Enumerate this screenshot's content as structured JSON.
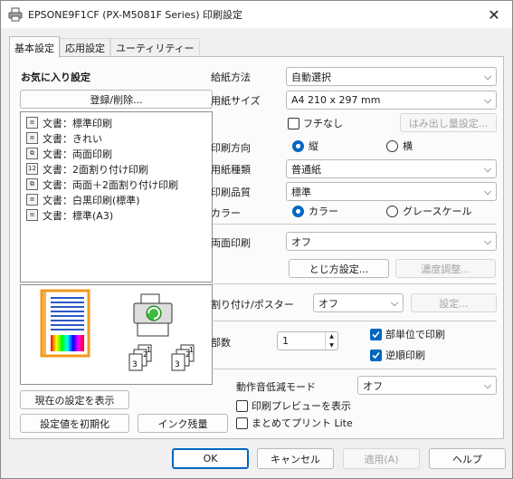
{
  "window": {
    "title": "EPSONE9F1CF (PX-M5081F Series) 印刷設定"
  },
  "tabs": [
    "基本設定",
    "応用設定",
    "ユーティリティー"
  ],
  "favorites": {
    "title": "お気に入り設定",
    "register_button": "登録/削除...",
    "items": [
      "文書：標準印刷",
      "文書：きれい",
      "文書：両面印刷",
      "文書：2面割り付け印刷",
      "文書：両面＋2面割り付け印刷",
      "文書：白黒印刷(標準)",
      "文書：標準(A3)"
    ],
    "item_icons": [
      "document-icon",
      "document-icon",
      "duplex-icon",
      "two-up-icon",
      "duplex-two-up-icon",
      "mono-document-icon",
      "document-icon"
    ]
  },
  "left_buttons": {
    "show_current": "現在の設定を表示",
    "reset": "設定値を初期化",
    "ink_level": "インク残量"
  },
  "settings": {
    "paper_source_label": "給紙方法",
    "paper_source_value": "自動選択",
    "paper_size_label": "用紙サイズ",
    "paper_size_value": "A4 210 x 297 mm",
    "borderless_label": "フチなし",
    "overflow_button": "はみ出し量設定...",
    "orientation_label": "印刷方向",
    "orientation_portrait": "縦",
    "orientation_landscape": "横",
    "paper_type_label": "用紙種類",
    "paper_type_value": "普通紙",
    "quality_label": "印刷品質",
    "quality_value": "標準",
    "color_label": "カラー",
    "color_option": "カラー",
    "grayscale_option": "グレースケール",
    "duplex_label": "両面印刷",
    "duplex_value": "オフ",
    "binding_button": "とじ方設定...",
    "density_button": "濃度調整...",
    "layout_label": "割り付け/ポスター",
    "layout_value": "オフ",
    "layout_settings_button": "設定...",
    "copies_label": "部数",
    "copies_value": "1",
    "collate_label": "部単位で印刷",
    "reverse_label": "逆順印刷",
    "quiet_mode_label": "動作音低減モード",
    "quiet_mode_value": "オフ",
    "print_preview_label": "印刷プレビューを表示",
    "lite_label": "まとめてプリント Lite"
  },
  "footer": {
    "ok": "OK",
    "cancel": "キャンセル",
    "apply": "適用(A)",
    "help": "ヘルプ"
  },
  "colors": {
    "accent": "#0067c0",
    "window_bg": "#f0f0f0",
    "panel_bg": "#fbfbfb"
  }
}
